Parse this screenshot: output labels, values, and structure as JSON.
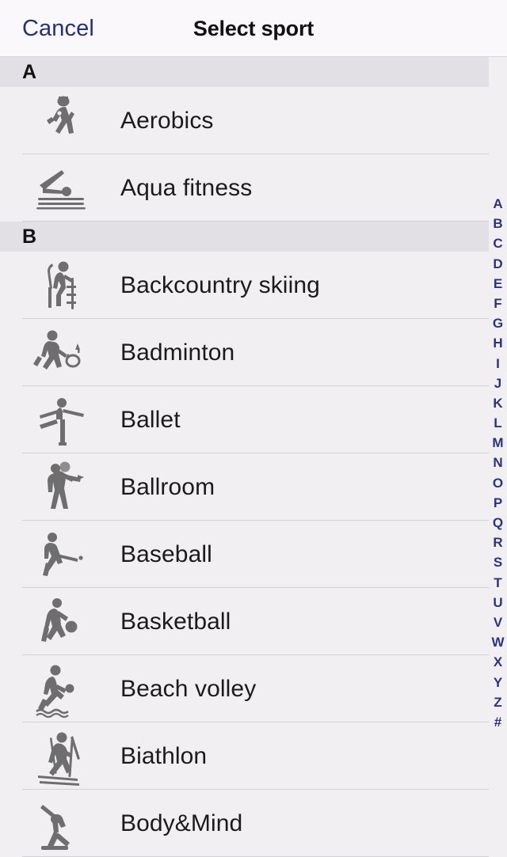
{
  "header": {
    "cancel_label": "Cancel",
    "title": "Select sport"
  },
  "colors": {
    "accent_blue": "#26307a",
    "index_blue": "#2a3480",
    "row_bg": "#f1eff2",
    "section_bg": "#e2e0e4",
    "header_bg": "#faf8fb",
    "icon_gray": "#6e6e6e",
    "separator": "#d3d1d6",
    "label_text": "#1b1b1b"
  },
  "list": [
    {
      "type": "section",
      "letter": "A"
    },
    {
      "type": "item",
      "label": "Aerobics",
      "icon": "aerobics-icon"
    },
    {
      "type": "item",
      "label": "Aqua fitness",
      "icon": "aqua-fitness-icon"
    },
    {
      "type": "section",
      "letter": "B"
    },
    {
      "type": "item",
      "label": "Backcountry skiing",
      "icon": "backcountry-skiing-icon"
    },
    {
      "type": "item",
      "label": "Badminton",
      "icon": "badminton-icon"
    },
    {
      "type": "item",
      "label": "Ballet",
      "icon": "ballet-icon"
    },
    {
      "type": "item",
      "label": "Ballroom",
      "icon": "ballroom-icon"
    },
    {
      "type": "item",
      "label": "Baseball",
      "icon": "baseball-icon"
    },
    {
      "type": "item",
      "label": "Basketball",
      "icon": "basketball-icon"
    },
    {
      "type": "item",
      "label": "Beach volley",
      "icon": "beach-volley-icon"
    },
    {
      "type": "item",
      "label": "Biathlon",
      "icon": "biathlon-icon"
    },
    {
      "type": "item",
      "label": "Body&Mind",
      "icon": "body-and-mind-icon"
    }
  ],
  "alpha_index": [
    "A",
    "B",
    "C",
    "D",
    "E",
    "F",
    "G",
    "H",
    "I",
    "J",
    "K",
    "L",
    "M",
    "N",
    "O",
    "P",
    "Q",
    "R",
    "S",
    "T",
    "U",
    "V",
    "W",
    "X",
    "Y",
    "Z",
    "#"
  ]
}
